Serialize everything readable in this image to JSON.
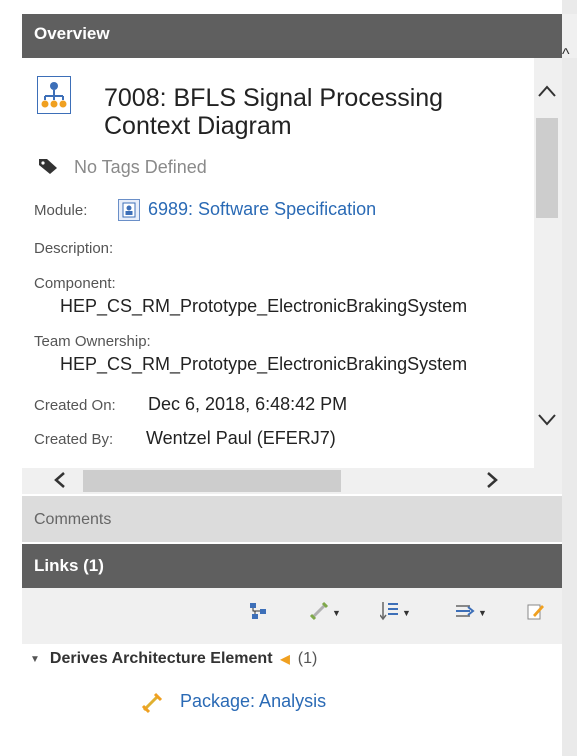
{
  "overview": {
    "header": "Overview",
    "title_line1": "7008: BFLS Signal Processing",
    "title_line2": "Context Diagram",
    "tags_text": "No Tags Defined",
    "module_label": "Module:",
    "module_link": "6989: Software Specification",
    "description_label": "Description:",
    "component_label": "Component:",
    "component_value": "HEP_CS_RM_Prototype_ElectronicBrakingSystem",
    "team_label": "Team Ownership:",
    "team_value": "HEP_CS_RM_Prototype_ElectronicBrakingSystem",
    "created_on_label": "Created On:",
    "created_on_value": "Dec 6, 2018, 6:48:42 PM",
    "created_by_label": "Created By:",
    "created_by_value": "Wentzel Paul (EFERJ7)"
  },
  "comments": {
    "label": "Comments"
  },
  "links": {
    "header": "Links (1)",
    "group_label": "Derives Architecture Element",
    "group_count": "(1)",
    "item_label": "Package: Analysis"
  },
  "icons": {
    "doc": "diagram-icon",
    "tag": "tag-icon",
    "module": "module-icon",
    "package": "package-icon"
  },
  "colors": {
    "header_bg": "#5f5f5f",
    "link": "#2a6ab5",
    "comments_bg": "#dcdcdc",
    "toolbar_bg": "#f0f0f0",
    "arrow_accent": "#f0a020"
  }
}
